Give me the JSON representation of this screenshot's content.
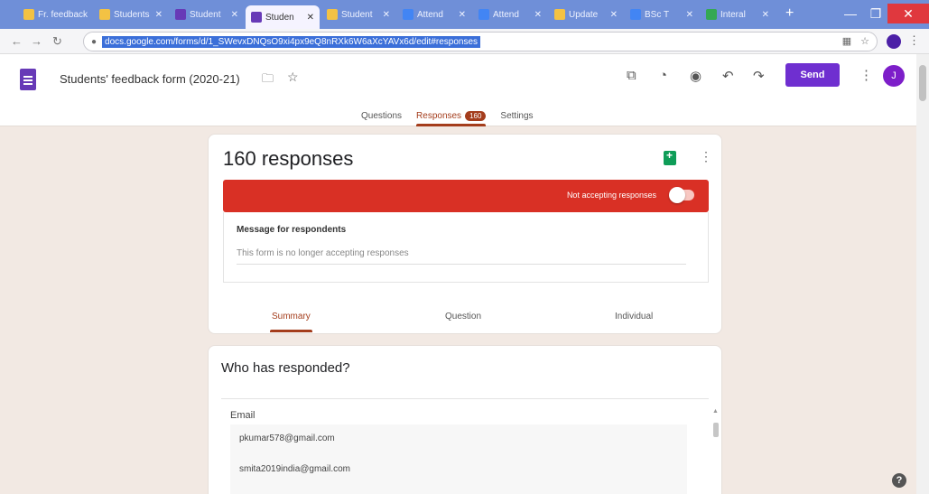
{
  "browser": {
    "tabs": [
      {
        "label": "Fr. feedback",
        "fav_color": "#f3c244"
      },
      {
        "label": "Students",
        "fav_color": "#f3c244"
      },
      {
        "label": "Student",
        "fav_color": "#673ab7"
      },
      {
        "label": "Studen",
        "fav_color": "#673ab7"
      },
      {
        "label": "Student",
        "fav_color": "#f3c244"
      },
      {
        "label": "Attend",
        "fav_color": "#4285f4"
      },
      {
        "label": "Attend",
        "fav_color": "#4285f4"
      },
      {
        "label": "Update",
        "fav_color": "#f3c244"
      },
      {
        "label": "BSc T",
        "fav_color": "#4285f4"
      },
      {
        "label": "Interal",
        "fav_color": "#34a853"
      }
    ],
    "url": "docs.google.com/forms/d/1_SWevxDNQsO9xi4px9eQ8nRXk6W6aXcYAVx6d/edit#responses"
  },
  "form": {
    "title": "Students' feedback form (2020-21)",
    "send_label": "Send",
    "avatar_letter": "J",
    "tabs": {
      "questions": "Questions",
      "responses": "Responses",
      "responses_badge": "160",
      "settings": "Settings"
    }
  },
  "responses": {
    "count_label": "160 responses",
    "accepting_label": "Not accepting responses",
    "message_label": "Message for respondents",
    "message_value": "This form is no longer accepting responses",
    "view_tabs": {
      "summary": "Summary",
      "question": "Question",
      "individual": "Individual"
    }
  },
  "who": {
    "title": "Who has responded?",
    "email_label": "Email",
    "emails": [
      "pkumar578@gmail.com",
      "smita2019india@gmail.com"
    ]
  }
}
